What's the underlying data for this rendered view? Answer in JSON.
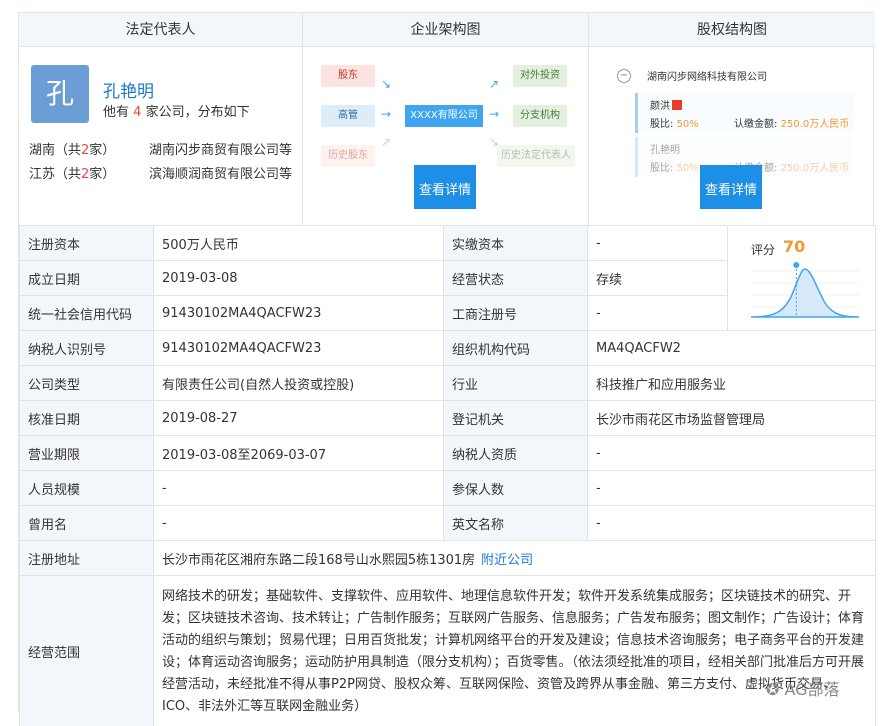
{
  "panels": {
    "legal_rep": {
      "title": "法定代表人",
      "avatar_char": "孔",
      "name": "孔艳明",
      "count_prefix": "他有",
      "count": "4",
      "count_suffix": "家公司，分布如下",
      "regions": [
        {
          "prefix": "湖南（共",
          "n": "2",
          "suffix": "家）",
          "company": "湖南闪步商贸有限公司等"
        },
        {
          "prefix": "江苏（共",
          "n": "2",
          "suffix": "家）",
          "company": "滨海顺润商贸有限公司等"
        }
      ]
    },
    "org": {
      "title": "企业架构图",
      "left": [
        "股东",
        "高管",
        "历史股东"
      ],
      "center": "XXXX有限公司",
      "right": [
        "对外投资",
        "分支机构",
        "历史法定代表人"
      ],
      "button": "查看详情"
    },
    "equity": {
      "title": "股权结构图",
      "root": "湖南闪步网络科技有限公司",
      "holders": [
        {
          "name": "颜洪",
          "ratio_label": "股比:",
          "ratio": "50%",
          "amount_label": "认缴金额:",
          "amount": "250.0万人民币"
        },
        {
          "name": "孔艳明",
          "ratio_label": "股比:",
          "ratio": "50%",
          "amount_label": "认缴金额:",
          "amount": "250.0万人民币"
        }
      ],
      "button": "查看详情"
    }
  },
  "info": {
    "reg_capital": {
      "k": "注册资本",
      "v": "500万人民币"
    },
    "paid_capital": {
      "k": "实缴资本",
      "v": "-"
    },
    "est_date": {
      "k": "成立日期",
      "v": "2019-03-08"
    },
    "status": {
      "k": "经营状态",
      "v": "存续"
    },
    "credit_code": {
      "k": "统一社会信用代码",
      "v": "91430102MA4QACFW23"
    },
    "biz_reg_no": {
      "k": "工商注册号",
      "v": "-"
    },
    "tax_id": {
      "k": "纳税人识别号",
      "v": "91430102MA4QACFW23"
    },
    "org_code": {
      "k": "组织机构代码",
      "v": "MA4QACFW2"
    },
    "co_type": {
      "k": "公司类型",
      "v": "有限责任公司(自然人投资或控股)"
    },
    "industry": {
      "k": "行业",
      "v": "科技推广和应用服务业"
    },
    "approve_date": {
      "k": "核准日期",
      "v": "2019-08-27"
    },
    "reg_authority": {
      "k": "登记机关",
      "v": "长沙市雨花区市场监督管理局"
    },
    "biz_term": {
      "k": "营业期限",
      "v": "2019-03-08至2069-03-07"
    },
    "taxpayer_qual": {
      "k": "纳税人资质",
      "v": "-"
    },
    "staff_size": {
      "k": "人员规模",
      "v": "-"
    },
    "insured": {
      "k": "参保人数",
      "v": "-"
    },
    "former_name": {
      "k": "曾用名",
      "v": "-"
    },
    "english_name": {
      "k": "英文名称",
      "v": "-"
    },
    "address": {
      "k": "注册地址",
      "v": "长沙市雨花区湘府东路二段168号山水熙园5栋1301房",
      "link": "附近公司"
    },
    "scope": {
      "k": "经营范围",
      "v": "网络技术的研发；基础软件、支撑软件、应用软件、地理信息软件开发；软件开发系统集成服务；区块链技术的研究、开发；区块链技术咨询、技术转让；广告制作服务；互联网广告服务、信息服务；广告发布服务；图文制作；广告设计；体育活动的组织与策划；贸易代理；日用百货批发；计算机网络平台的开发及建设；信息技术咨询服务；电子商务平台的开发建设；体育运动咨询服务；运动防护用具制造（限分支机构）；百货零售。（依法须经批准的项目，经相关部门批准后方可开展经营活动，未经批准不得从事P2P网贷、股权众筹、互联网保险、资管及跨界从事金融、第三方支付、虚拟货币交易、ICO、非法外汇等互联网金融业务）"
    }
  },
  "score": {
    "label": "评分",
    "value": "70",
    "marker_fraction": 0.42
  },
  "watermark": "AG部落",
  "colors": {
    "accent": "#1e8fe6",
    "orange": "#f09b2e",
    "red": "#e44b3c",
    "header_bg": "#f3f7fb"
  }
}
